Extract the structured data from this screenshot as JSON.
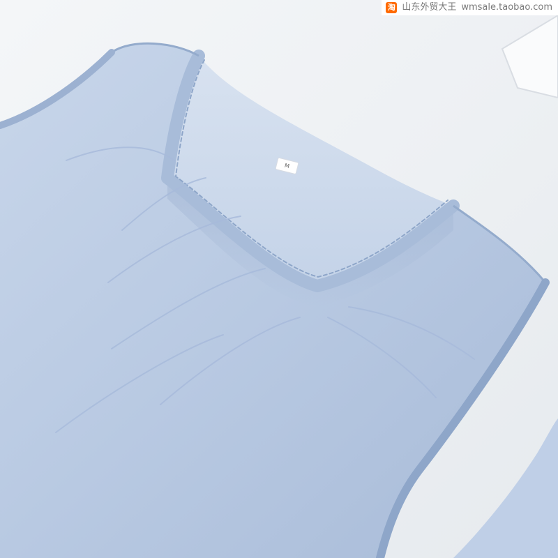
{
  "watermark": {
    "icon_name": "taobao-icon",
    "icon_glyph": "淘",
    "shop_name": "山东外贸大王",
    "url": "wmsale.taobao.com"
  },
  "product": {
    "size_tag": "M",
    "garment_color": "#b9cbe3",
    "seam_color": "#91a8c8",
    "background_color": "#eef0f3"
  }
}
